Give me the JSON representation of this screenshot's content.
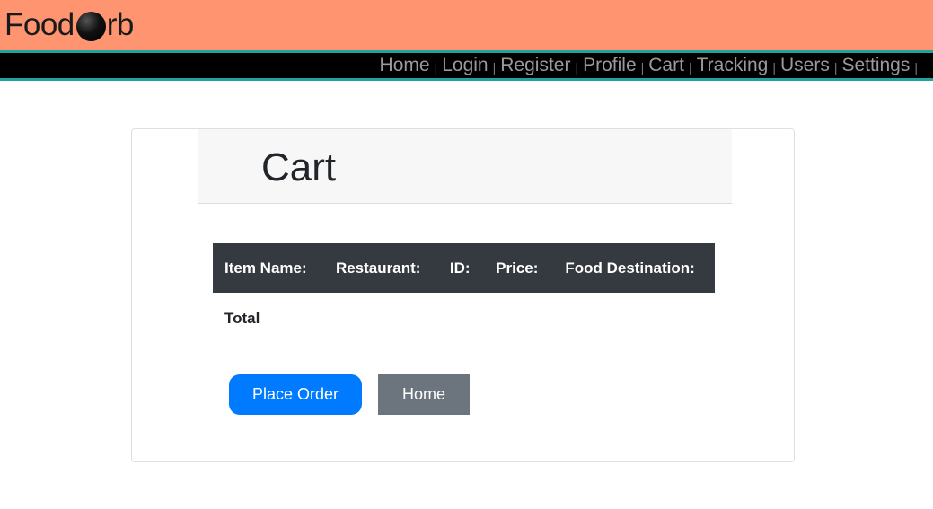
{
  "brand": {
    "before": "Food",
    "after": "rb"
  },
  "nav": {
    "items": [
      "Home",
      "Login",
      "Register",
      "Profile",
      "Cart",
      "Tracking",
      "Users",
      "Settings"
    ],
    "separator": "|"
  },
  "cart": {
    "title": "Cart",
    "columns": [
      "Item Name:",
      "Restaurant:",
      "ID:",
      "Price:",
      "Food Destination:"
    ],
    "total_label": "Total"
  },
  "buttons": {
    "place_order": "Place Order",
    "home": "Home"
  },
  "colors": {
    "header_bg": "#ff9470",
    "nav_bg": "#000000",
    "nav_border": "#20a39e",
    "table_head": "#343a40",
    "primary": "#007bff",
    "secondary": "#6c757d"
  }
}
